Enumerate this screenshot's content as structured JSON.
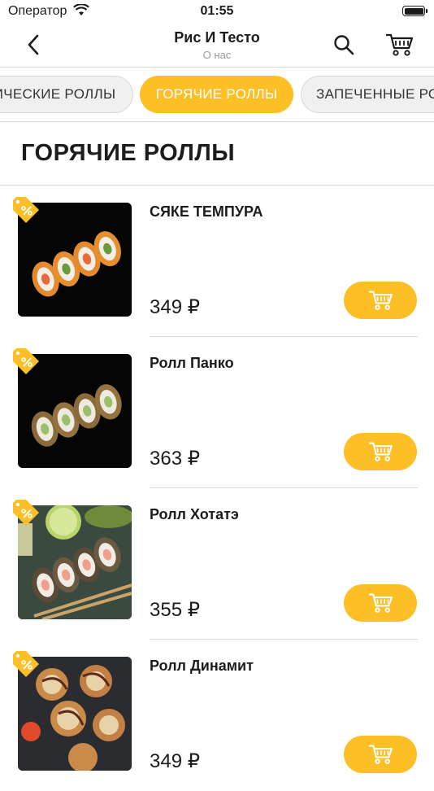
{
  "status_bar": {
    "carrier": "Оператор",
    "time": "01:55"
  },
  "header": {
    "title": "Рис И Тесто",
    "subtitle": "О нас"
  },
  "categories": [
    {
      "label": "ИЧЕСКИЕ РОЛЛЫ",
      "active": false
    },
    {
      "label": "ГОРЯЧИЕ РОЛЛЫ",
      "active": true
    },
    {
      "label": "ЗАПЕЧЕННЫЕ РОЛ",
      "active": false
    }
  ],
  "section": {
    "title": "ГОРЯЧИЕ РОЛЛЫ"
  },
  "products": [
    {
      "name": "СЯКЕ ТЕМПУРА",
      "price": "349 ₽"
    },
    {
      "name": "Ролл Панко",
      "price": "363 ₽"
    },
    {
      "name": "Ролл Хотатэ",
      "price": "355 ₽"
    },
    {
      "name": "Ролл Динамит",
      "price": "349 ₽"
    }
  ],
  "colors": {
    "accent": "#fcbf26",
    "chip_inactive": "#f0f0f0",
    "divider": "#dcdcdc"
  },
  "icons": {
    "back": "chevron-left-icon",
    "search": "search-icon",
    "cart": "cart-icon",
    "discount": "discount-tag-icon",
    "add_to_cart": "add-to-cart-icon"
  }
}
